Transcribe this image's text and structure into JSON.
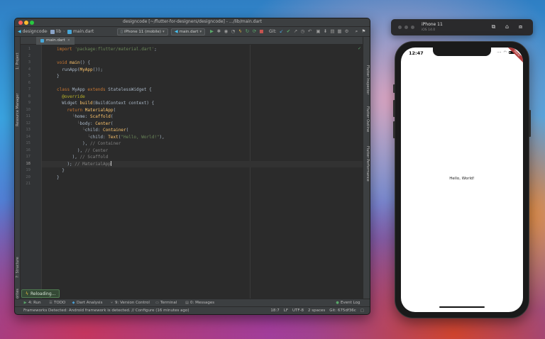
{
  "ide": {
    "window_title": "designcode [~/flutter-for-designers/designcode] - .../lib/main.dart",
    "breadcrumb": [
      "designcode",
      "lib",
      "main.dart"
    ],
    "device_selector": "iPhone 11 (mobile)",
    "run_config": "main.dart",
    "git_label": "Git:",
    "open_tab": "main.dart",
    "left_tools": [
      "1: Project",
      "Resource Manager",
      "7: Structure",
      "2: Favorites"
    ],
    "right_tools": [
      "Flutter Inspector",
      "Flutter Outline",
      "Flutter Performance"
    ],
    "code_lines": [
      {
        "n": "1",
        "html": "<span class=\"kw\">import</span> <span class=\"str\">'package:flutter/material.dart'</span>;"
      },
      {
        "n": "2",
        "html": ""
      },
      {
        "n": "3",
        "html": "<span class=\"kw\">void</span> <span class=\"fn\">main</span>() {"
      },
      {
        "n": "4",
        "html": "  runApp(<span class=\"fn\">MyApp</span>());"
      },
      {
        "n": "5",
        "html": "}"
      },
      {
        "n": "6",
        "html": ""
      },
      {
        "n": "7",
        "html": "<span class=\"kw\">class</span> MyApp <span class=\"kw\">extends</span> StatelessWidget {"
      },
      {
        "n": "8",
        "html": "  <span class=\"ann\">@override</span>"
      },
      {
        "n": "9",
        "html": "  Widget <span class=\"fn\">build</span>(BuildContext context) {"
      },
      {
        "n": "10",
        "html": "    <span class=\"kw\">return</span> <span class=\"fn\">MaterialApp</span>("
      },
      {
        "n": "11",
        "html": "      <span class=\"guide\">└</span>home: <span class=\"fn\">Scaffold</span>("
      },
      {
        "n": "12",
        "html": "        <span class=\"guide\">└</span>body: <span class=\"fn\">Center</span>("
      },
      {
        "n": "13",
        "html": "          <span class=\"guide\">└</span>child: <span class=\"fn\">Container</span>("
      },
      {
        "n": "14",
        "html": "            <span class=\"guide\">└</span>child: <span class=\"fn\">Text</span>(<span class=\"str\">\"Hello, World!\"</span>),"
      },
      {
        "n": "15",
        "html": "          ), <span class=\"cm\">// Container</span>"
      },
      {
        "n": "16",
        "html": "        ), <span class=\"cm\">// Center</span>"
      },
      {
        "n": "17",
        "html": "      ), <span class=\"cm\">// Scaffold</span>"
      },
      {
        "n": "18",
        "html": "    ); <span class=\"cm\">// MaterialApp</span><span class=\"caret\"></span>"
      },
      {
        "n": "19",
        "html": "  }"
      },
      {
        "n": "20",
        "html": "}"
      },
      {
        "n": "21",
        "html": ""
      }
    ],
    "current_line": "18",
    "reload_popup": "Reloading...",
    "bottom_tools": {
      "run": "4: Run",
      "todo": "TODO",
      "dart_analysis": "Dart Analysis",
      "version_control": "9: Version Control",
      "terminal": "Terminal",
      "messages": "0: Messages",
      "event_log": "Event Log"
    },
    "status": {
      "message": "Frameworks Detected: Android framework is detected. // Configure (16 minutes ago)",
      "position": "18:7",
      "line_ending": "LF",
      "encoding": "UTF-8",
      "indent": "2 spaces",
      "git_branch": "Git: 675df36c"
    }
  },
  "simulator": {
    "device_name": "iPhone 11",
    "os_version": "iOS 14.0",
    "time": "12:47",
    "debug_banner": "DEBUG",
    "hello_text": "Hello, World!"
  },
  "colors": {
    "ide_bg": "#2b2b2b",
    "keyword": "#cc7832",
    "string": "#6a8759",
    "function": "#ffc66d",
    "comment": "#808080",
    "annotation": "#bbb529"
  }
}
